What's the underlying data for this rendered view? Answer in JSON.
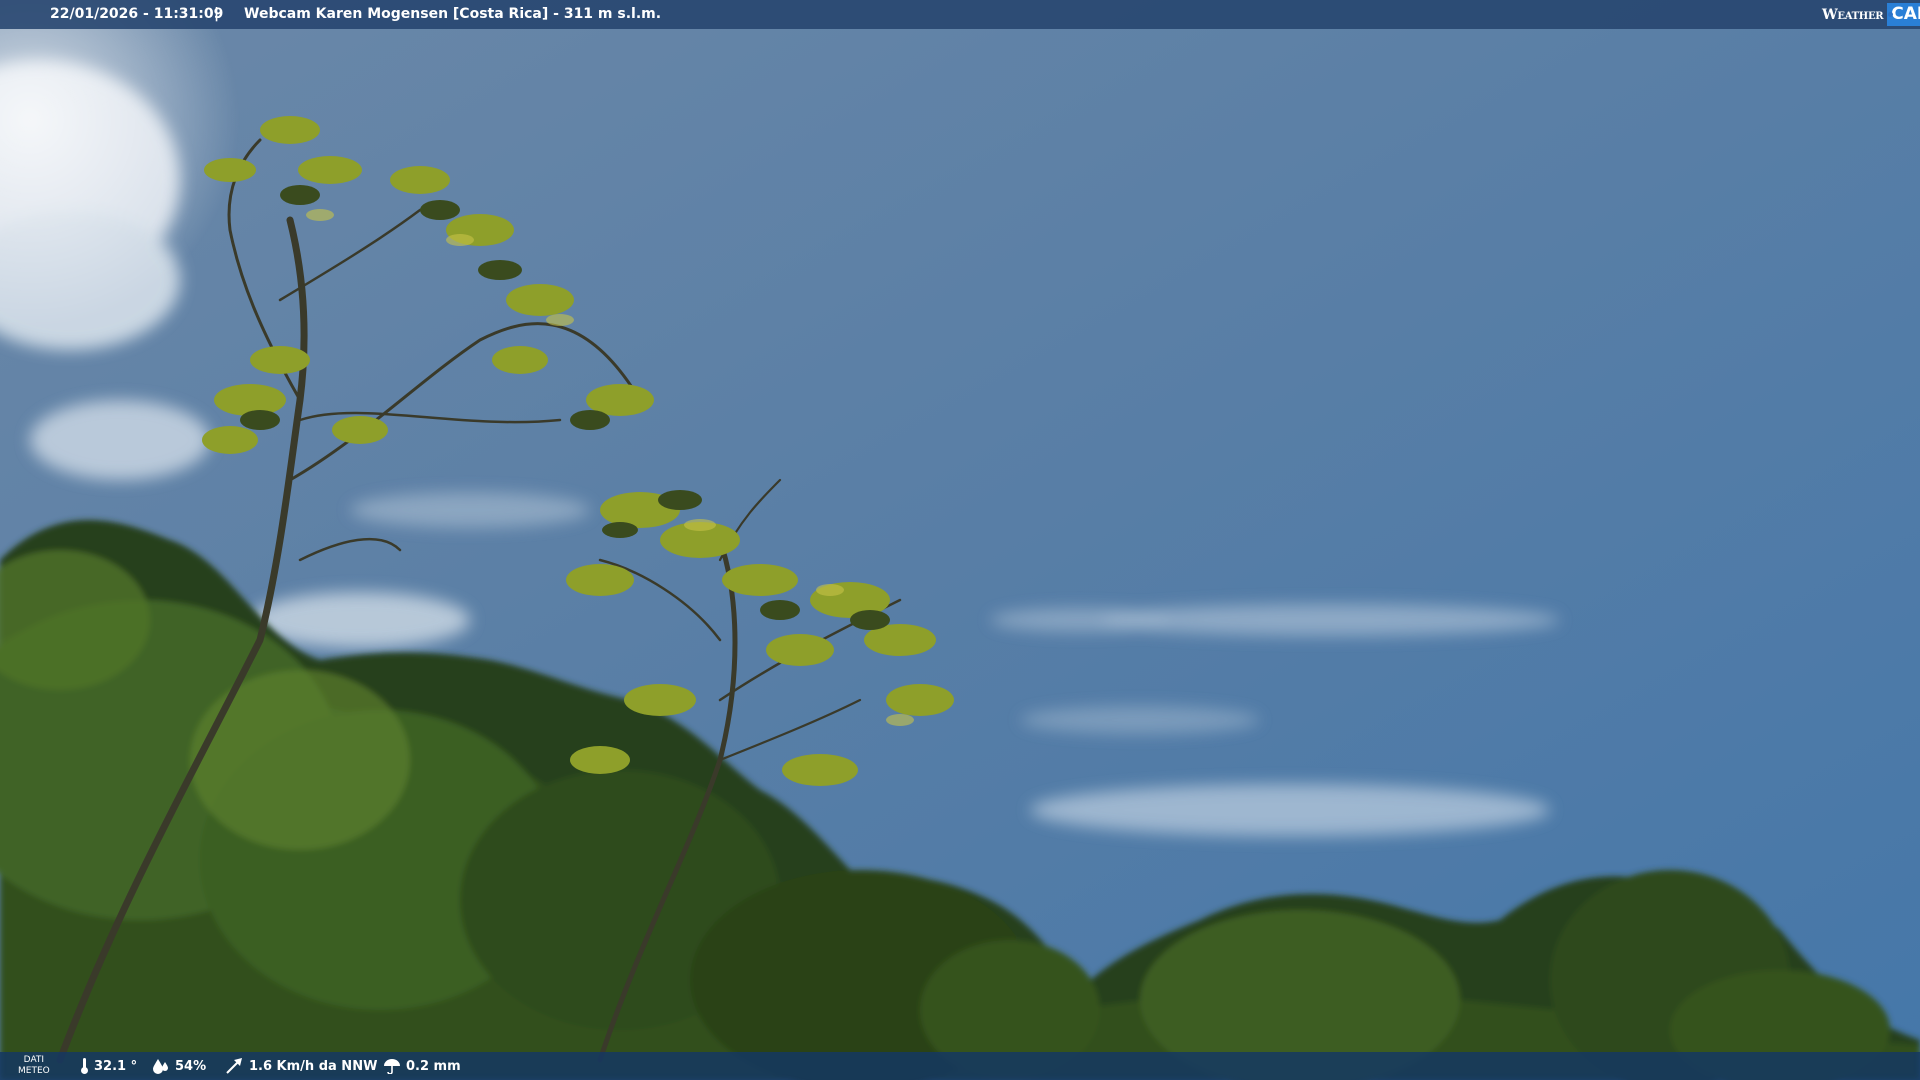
{
  "header": {
    "datetime": "22/01/2026 - 11:31:09",
    "separator": "|",
    "title": "Webcam Karen Mogensen [Costa Rica] - 311 m s.l.m."
  },
  "logo": {
    "weather": "Weather",
    "cam": "CAM"
  },
  "meteo": {
    "label_line1": "DATI",
    "label_line2": "METEO",
    "temperature": "32.1 °",
    "humidity": "54%",
    "wind": "1.6 Km/h da NNW",
    "rain": "0.2 mm"
  },
  "colors": {
    "sky_top": "#5b7799",
    "sky_mid": "#4f78a6",
    "foliage_dark": "#1e3a16",
    "foliage_light": "#a7b83a",
    "bar": "#26446e",
    "logo_accent": "#2a7fd6"
  }
}
